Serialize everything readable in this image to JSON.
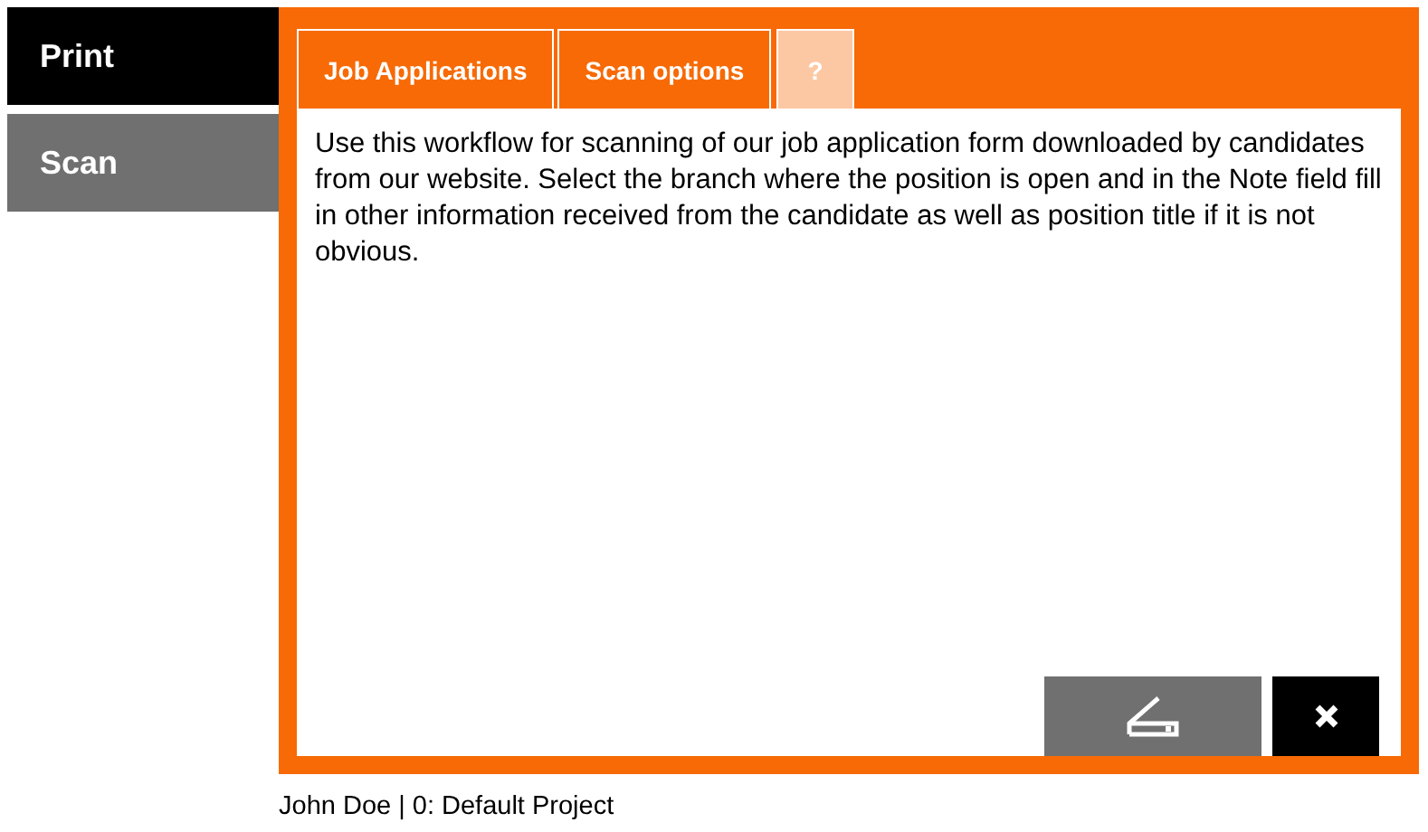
{
  "sidebar": {
    "items": [
      {
        "label": "Print",
        "selected": true
      },
      {
        "label": "Scan",
        "selected": false
      }
    ]
  },
  "tabs": [
    {
      "label": "Job Applications",
      "disabled": false
    },
    {
      "label": "Scan options",
      "disabled": false
    },
    {
      "label": "?",
      "disabled": true
    }
  ],
  "description": "Use this workflow for scanning of our job application form downloaded by candidates from our website. Select the branch where the position is open and in the Note field fill in other information received from the candidate as well as position title if it is not obvious.",
  "status_bar": "John Doe | 0: Default Project"
}
